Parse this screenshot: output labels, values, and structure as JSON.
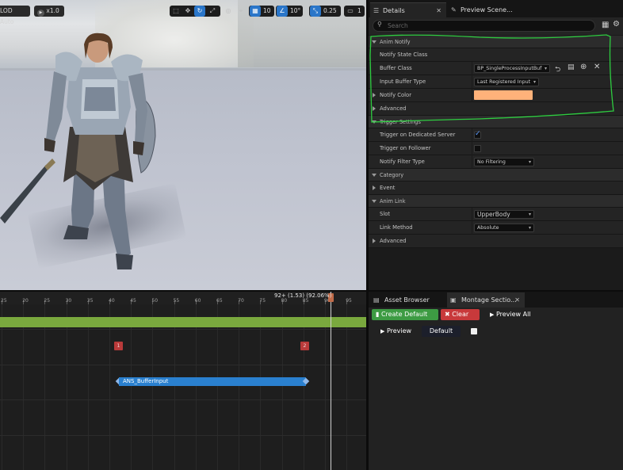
{
  "viewport": {
    "lod_label": "LOD Auto",
    "play_rate": "x1.0",
    "grid_value": "10",
    "angle_value": "10°",
    "scale_value": "0.25",
    "camera_value": "1"
  },
  "details": {
    "tabs": [
      {
        "label": "Details",
        "active": true
      },
      {
        "label": "Preview Scene..."
      }
    ],
    "search_placeholder": "Search",
    "categories": {
      "anim_notify": "Anim Notify",
      "trigger_settings": "Trigger Settings",
      "category": "Category",
      "anim_link": "Anim Link"
    },
    "rows": {
      "notify_state_class": "Notify State Class",
      "buffer_class_label": "Buffer Class",
      "buffer_class_value": "BP_SingleProcessInputBuf",
      "input_buffer_type_label": "Input Buffer Type",
      "input_buffer_type_value": "Last Registered Input",
      "notify_color_label": "Notify Color",
      "advanced_1": "Advanced",
      "trigger_dedicated_label": "Trigger on Dedicated Server",
      "trigger_follower_label": "Trigger on Follower",
      "notify_filter_label": "Notify Filter Type",
      "notify_filter_value": "No Filtering",
      "event_label": "Event",
      "slot_label": "Slot",
      "slot_value": "UpperBody",
      "link_method_label": "Link Method",
      "link_method_value": "Absolute",
      "advanced_2": "Advanced"
    },
    "notify_color_hex": "#ffb27a",
    "trigger_dedicated_checked": true,
    "trigger_follower_checked": false
  },
  "timeline": {
    "ticks": [
      "25",
      "20",
      "25",
      "30",
      "35",
      "40",
      "45",
      "50",
      "55",
      "60",
      "65",
      "70",
      "75",
      "80",
      "85",
      "90",
      "95"
    ],
    "time_readout": "92+ (1.53) (92.06%)",
    "section_markers": [
      "1",
      "2"
    ],
    "notify_label": "ANS_BufferInput"
  },
  "montage": {
    "tabs": [
      {
        "label": "Asset Browser"
      },
      {
        "label": "Montage Sectio...",
        "active": true
      }
    ],
    "create_default": "Create Default",
    "clear": "Clear",
    "preview_all": "Preview All",
    "preview": "Preview",
    "default_section": "Default"
  },
  "colors": {
    "highlight_green": "#2ecc40",
    "notify_blue": "#2a80cf",
    "section_bar_green": "#7aa93e",
    "marker_red": "#b83a3a"
  }
}
